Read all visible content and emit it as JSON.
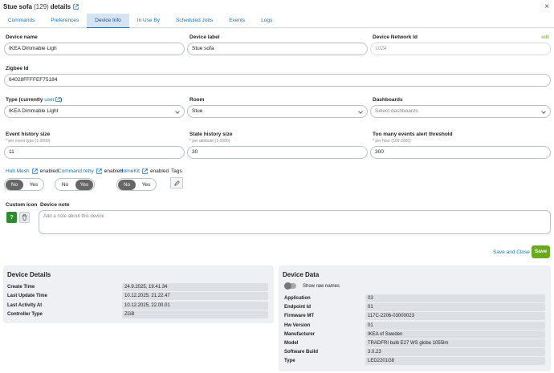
{
  "window": {
    "title": "Stue sofa",
    "count": "(129)",
    "suffix": "details",
    "close": "×"
  },
  "tabs": [
    "Commands",
    "Preferences",
    "Device Info",
    "In Use By",
    "Scheduled Jobs",
    "Events",
    "Logs"
  ],
  "active_tab": "Device Info",
  "edit_link": "edit",
  "fields": {
    "device_name": {
      "label": "Device name",
      "value": "IKEA Dimmable Ligh"
    },
    "device_label": {
      "label": "Device label",
      "value": "Stue sofa"
    },
    "network_id": {
      "label": "Device Network Id",
      "value": "1024"
    },
    "zigbee_id": {
      "label": "Zigbee Id",
      "value": "64028FFFFEF75184"
    },
    "type": {
      "label_prefix": "Type (currently ",
      "label_link": "user",
      "label_suffix": ")",
      "value": "IKEA Dimmable Light"
    },
    "room": {
      "label": "Room",
      "value": "Stue"
    },
    "dashboards": {
      "label": "Dashboards",
      "placeholder": "Select dashboards"
    },
    "event_history": {
      "label": "Event history size",
      "hint": "* per event type (1-2000)",
      "value": "11"
    },
    "state_history": {
      "label": "State history size",
      "hint": "* per attribute (1-2000)",
      "value": "30"
    },
    "too_many": {
      "label": "Too many events alert threshold",
      "hint": "* per hour (100-2000)",
      "value": "300"
    }
  },
  "flags": {
    "hub_mesh": {
      "link": "Hub Mesh",
      "status": "enabled",
      "no": "No",
      "yes": "Yes",
      "selected": "No"
    },
    "command_retry": {
      "link": "Command retry",
      "status": "enabled",
      "no": "No",
      "yes": "Yes",
      "selected": "Yes"
    },
    "homekit": {
      "link": "HomeKit",
      "status": "enabled",
      "no": "No",
      "yes": "Yes",
      "selected": "No"
    },
    "tags_label": "Tags"
  },
  "custom_icon": {
    "label": "Custom icon",
    "icon_text": "?"
  },
  "device_note": {
    "label": "Device note",
    "placeholder": "Add a note about this device"
  },
  "actions": {
    "save_close": "Save and Close",
    "save": "Save"
  },
  "device_details": {
    "title": "Device Details",
    "rows": [
      {
        "k": "Create Time",
        "v": "24.9.2025, 19.41.34"
      },
      {
        "k": "Last Update Time",
        "v": "10.12.2025, 21.22.47"
      },
      {
        "k": "Last Activity At",
        "v": "10.12.2025, 22.00.01"
      },
      {
        "k": "Controller Type",
        "v": "ZGB"
      }
    ]
  },
  "device_data": {
    "title": "Device Data",
    "raw_toggle": "Show raw names",
    "rows": [
      {
        "k": "Application",
        "v": "03"
      },
      {
        "k": "Endpoint Id",
        "v": "01"
      },
      {
        "k": "Firmware MT",
        "v": "117C-2206-03000023"
      },
      {
        "k": "Hw Version",
        "v": "01"
      },
      {
        "k": "Manufacturer",
        "v": "IKEA of Sweden"
      },
      {
        "k": "Model",
        "v": "TRADFRI bulb E27 WS globe 1055lm"
      },
      {
        "k": "Software Build",
        "v": "3.0.23"
      },
      {
        "k": "Type",
        "v": "LED2201G8"
      }
    ]
  },
  "colors": {
    "accent": "#1a73b8",
    "save": "#6aaa1e",
    "active_tab": "#d5e3f2"
  }
}
